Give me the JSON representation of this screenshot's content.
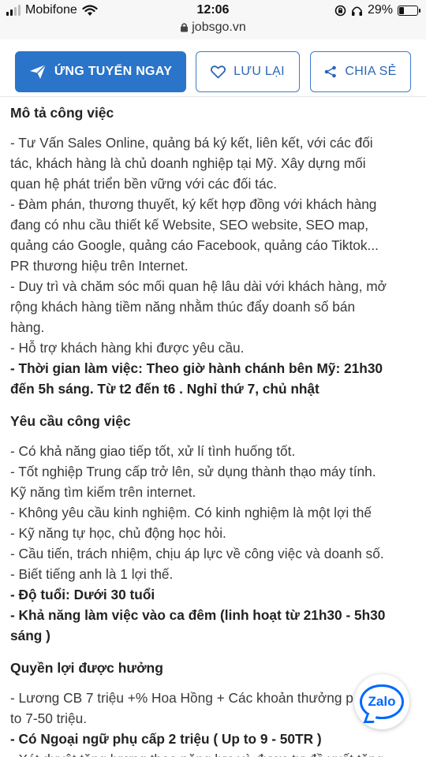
{
  "status_bar": {
    "carrier": "Mobifone",
    "time": "12:06",
    "battery": "29%",
    "battery_level": 0.29
  },
  "url_bar": {
    "domain": "jobsgo.vn"
  },
  "actions": {
    "apply_label": "ỨNG TUYỂN NGAY",
    "save_label": "LƯU LẠI",
    "share_label": "CHIA SẺ",
    "accent_color": "#2a74c9"
  },
  "sections": [
    {
      "title": "Mô tả công việc",
      "lines": [
        {
          "text": "- Tư Vấn Sales Online, quảng bá ký kết, liên kết, với các đối",
          "bold": false
        },
        {
          "text": "tác, khách hàng là chủ doanh nghiệp tại Mỹ. Xây dựng mối",
          "bold": false
        },
        {
          "text": "quan hệ phát triển bền vững với các đối tác.",
          "bold": false
        },
        {
          "text": "- Đàm phán, thương thuyết, ký kết hợp đồng với khách hàng",
          "bold": false
        },
        {
          "text": "đang có nhu cầu thiết kế Website, SEO website, SEO map,",
          "bold": false
        },
        {
          "text": "quảng cáo Google, quảng cáo Facebook, quảng cáo Tiktok...",
          "bold": false
        },
        {
          "text": "PR thương hiệu trên Internet.",
          "bold": false
        },
        {
          "text": "- Duy trì và chăm sóc mối quan hệ lâu dài với khách hàng, mở",
          "bold": false
        },
        {
          "text": "rộng khách hàng tiềm năng nhằm thúc đẩy doanh số bán",
          "bold": false
        },
        {
          "text": "hàng.",
          "bold": false
        },
        {
          "text": "- Hỗ trợ khách hàng khi được yêu cầu.",
          "bold": false
        },
        {
          "text": "- Thời gian làm việc: Theo giờ hành chánh bên Mỹ: 21h30",
          "bold": true
        },
        {
          "text": "đến 5h sáng. Từ t2 đến t6 . Nghỉ thứ 7, chủ nhật",
          "bold": true
        }
      ]
    },
    {
      "title": "Yêu cầu công việc",
      "lines": [
        {
          "text": "- Có khả năng giao tiếp tốt, xử lí tình huống tốt.",
          "bold": false
        },
        {
          "text": "- Tốt nghiệp Trung cấp trở lên, sử dụng thành thạo máy tính.",
          "bold": false
        },
        {
          "text": "Kỹ năng tìm kiếm trên internet.",
          "bold": false
        },
        {
          "text": "- Không yêu cầu kinh nghiệm. Có kinh nghiệm là một lợi thế",
          "bold": false
        },
        {
          "text": "- Kỹ năng tự học, chủ động học hỏi.",
          "bold": false
        },
        {
          "text": "- Cầu tiến, trách nhiệm, chịu áp lực về công việc và doanh số.",
          "bold": false
        },
        {
          "text": "- Biết tiếng anh là 1 lợi thế.",
          "bold": false
        },
        {
          "text": "- Độ tuổi: Dưới 30 tuổi",
          "bold": true
        },
        {
          "text": "- Khả năng làm việc vào ca đêm (linh hoạt từ 21h30 - 5h30",
          "bold": true
        },
        {
          "text": "sáng )",
          "bold": true
        }
      ]
    },
    {
      "title": "Quyền lợi được hưởng",
      "lines": [
        {
          "text": "- Lương CB 7 triệu +% Hoa Hồng + Các khoản thưởng     p",
          "bold": false
        },
        {
          "text": "to 7-50 triệu.",
          "bold": false
        },
        {
          "text": "- Có Ngoại ngữ phụ cấp 2 triệu ( Up to 9 - 50TR )",
          "bold": true
        },
        {
          "text": "- Xét duyệt tăng lương theo năng lực và được tự đề xuất tăng",
          "bold": false
        }
      ]
    }
  ],
  "zalo": {
    "label": "Zalo",
    "color": "#0068ff"
  }
}
